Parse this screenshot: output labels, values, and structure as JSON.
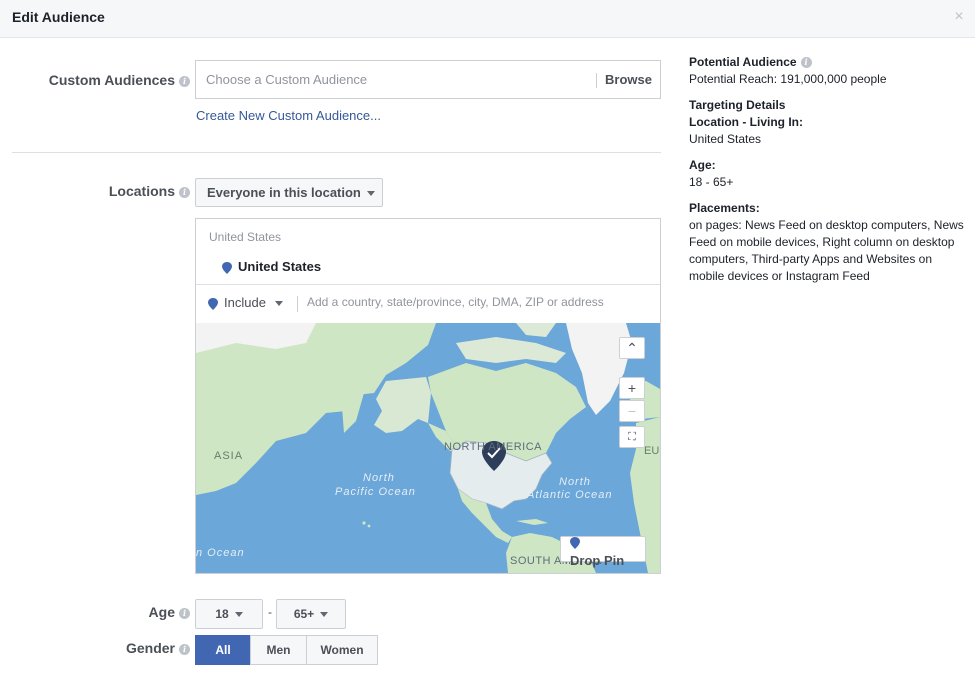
{
  "header": {
    "title": "Edit Audience",
    "close": "×"
  },
  "custom_audiences": {
    "label": "Custom Audiences",
    "placeholder": "Choose a Custom Audience",
    "browse_label": "Browse",
    "create_link": "Create New Custom Audience..."
  },
  "locations": {
    "label": "Locations",
    "mode": "Everyone in this location",
    "country_header": "United States",
    "selected": [
      "United States"
    ],
    "include_label": "Include",
    "search_placeholder": "Add a country, state/province, city, DMA, ZIP or address",
    "map_labels": {
      "asia": "ASIA",
      "north_america": "NORTH AMERICA",
      "north_pacific_1": "North",
      "north_pacific_2": "Pacific Ocean",
      "north_atlantic_1": "North",
      "north_atlantic_2": "Atlantic Ocean",
      "ocean": "n Ocean",
      "south_america": "SOUTH AMERICA",
      "eu": "EU",
      "south": "South"
    },
    "drop_pin_label": "Drop Pin",
    "zoom_in": "+",
    "zoom_out": "−",
    "collapse": "⌃",
    "fullscreen": "⛶"
  },
  "age": {
    "label": "Age",
    "min": "18",
    "max": "65+",
    "dash": "-"
  },
  "gender": {
    "label": "Gender",
    "options": [
      "All",
      "Men",
      "Women"
    ],
    "selected": "All"
  },
  "summary": {
    "potential_audience_title": "Potential Audience",
    "potential_reach": "Potential Reach: 191,000,000 people",
    "targeting_title": "Targeting Details",
    "location_title": "Location - Living In:",
    "location_value": "United States",
    "age_title": "Age:",
    "age_value": "18 - 65+",
    "placements_title": "Placements:",
    "placements_value": "on pages: News Feed on desktop computers, News Feed on mobile devices, Right column on desktop computers, Third-party Apps and Websites on mobile devices or Instagram Feed"
  },
  "colors": {
    "accent": "#4267b2",
    "link": "#365899",
    "map_water": "#6ca7d9",
    "map_land": "#cfe6c4",
    "map_ice": "#f2f3f2",
    "pin": "#2d3e5a"
  }
}
